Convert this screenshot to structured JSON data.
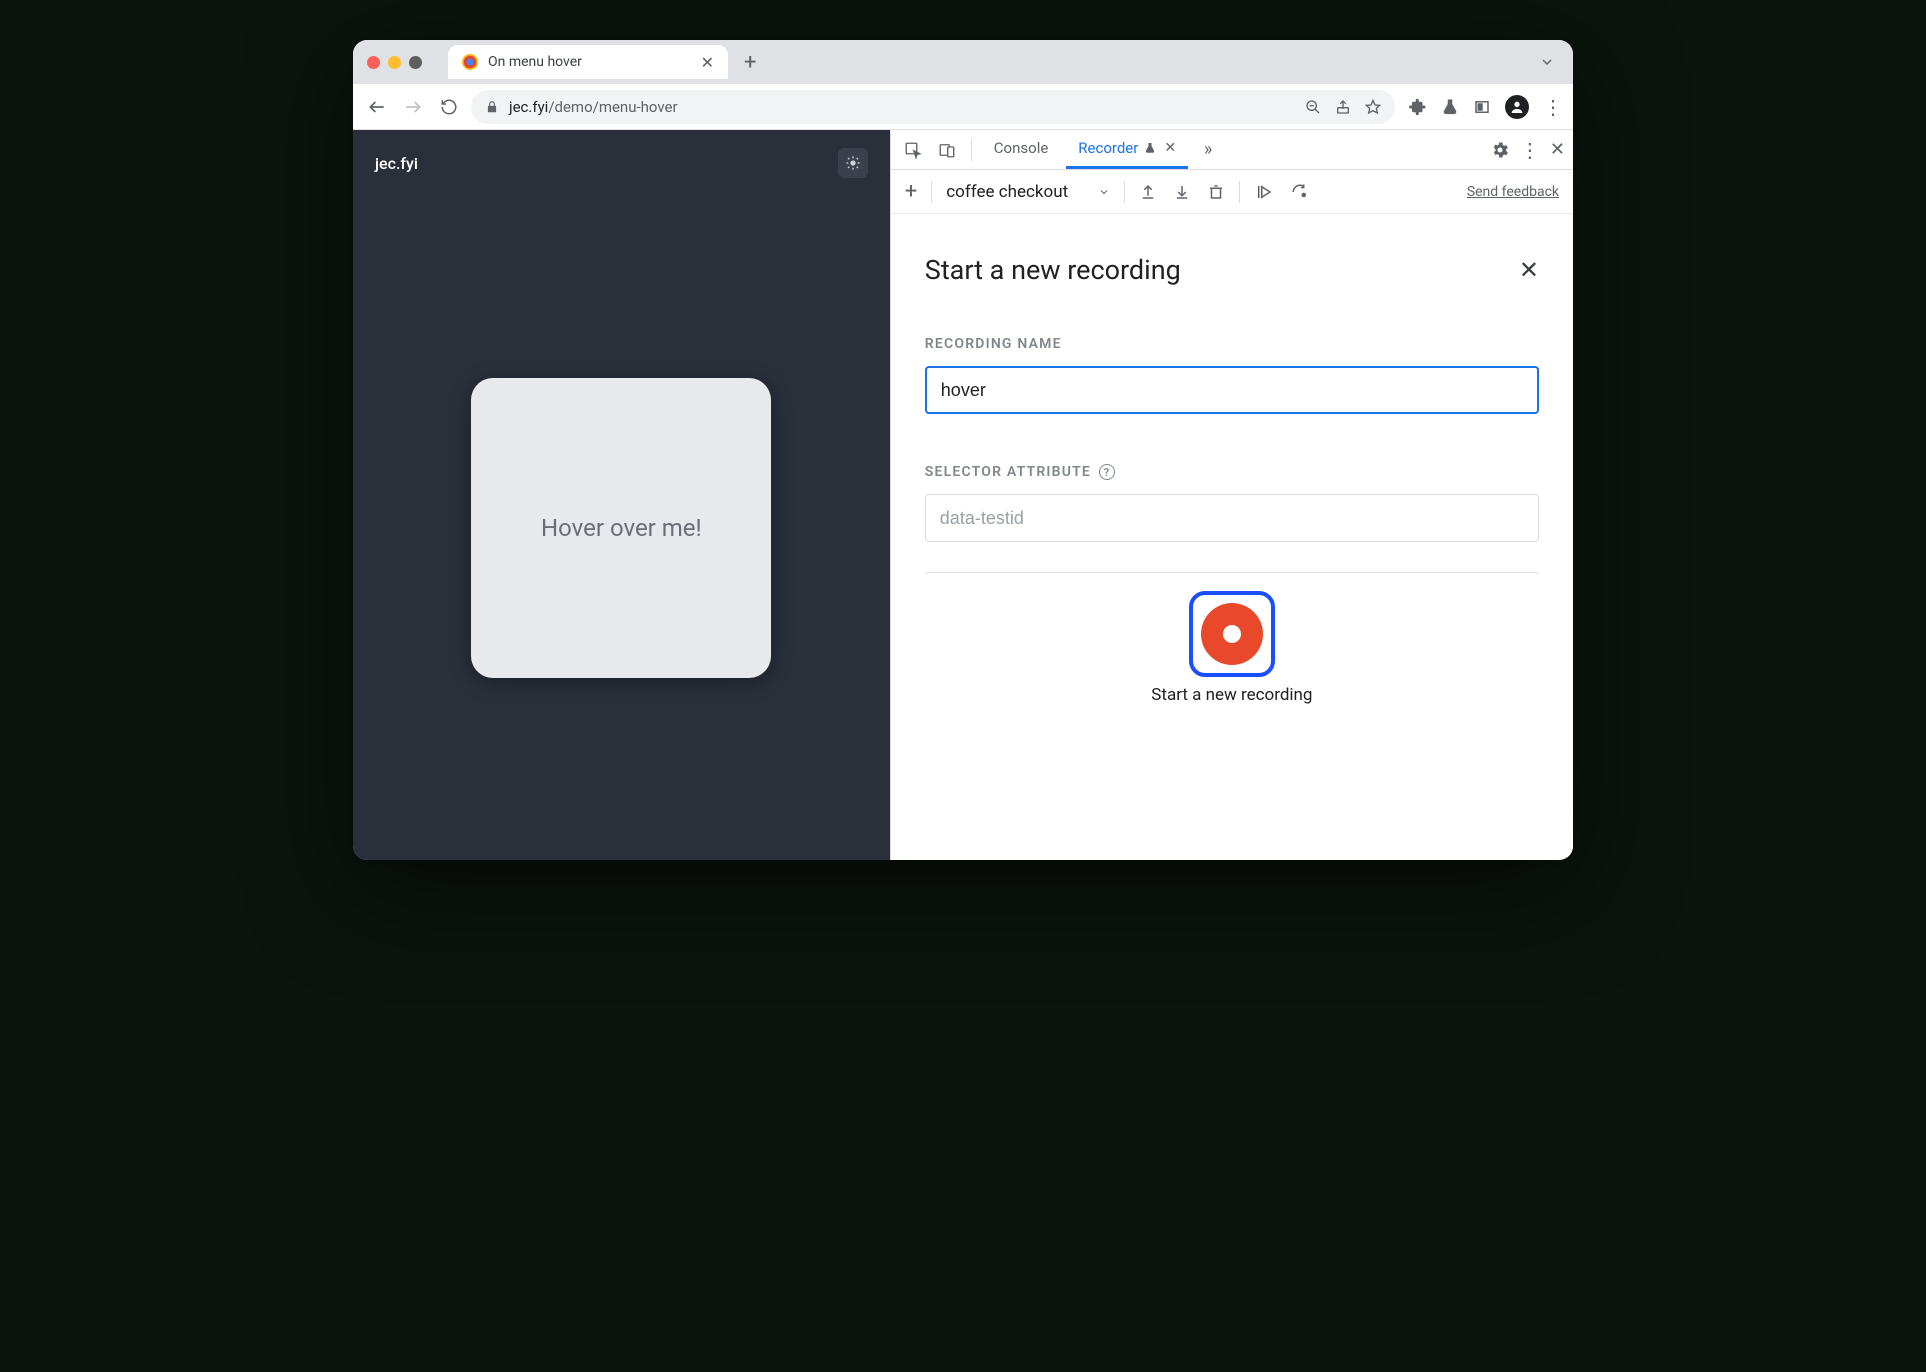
{
  "tab": {
    "title": "On menu hover"
  },
  "url": {
    "host": "jec.fyi",
    "path": "/demo/menu-hover"
  },
  "page": {
    "site_name": "jec.fyi",
    "card_text": "Hover over me!"
  },
  "devtools": {
    "tabs": {
      "console": "Console",
      "recorder": "Recorder"
    },
    "recorder": {
      "dropdown_value": "coffee checkout",
      "feedback": "Send feedback",
      "panel_title": "Start a new recording",
      "name_label": "RECORDING NAME",
      "name_value": "hover",
      "selector_label": "SELECTOR ATTRIBUTE",
      "selector_placeholder": "data-testid",
      "record_button_label": "Start a new recording"
    }
  }
}
